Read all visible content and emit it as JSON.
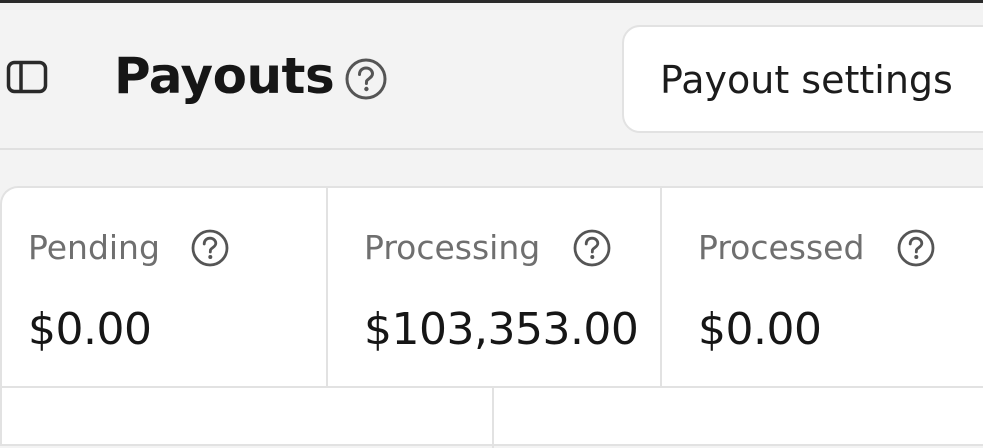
{
  "header": {
    "title": "Payouts",
    "settings_button_label": "Payout settings"
  },
  "icons": {
    "sidebar_toggle": "sidebar-panel-icon",
    "help": "question-circle-icon"
  },
  "stats": [
    {
      "label": "Pending",
      "value": "$0.00"
    },
    {
      "label": "Processing",
      "value": "$103,353.00"
    },
    {
      "label": "Processed",
      "value": "$0.00"
    }
  ]
}
